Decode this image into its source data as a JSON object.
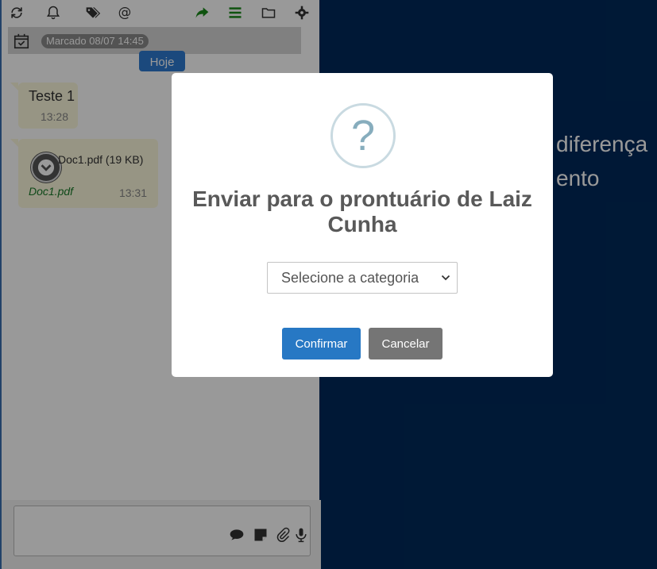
{
  "chat": {
    "scheduled_label": "Marcado 08/07 14:45",
    "day_badge": "Hoje",
    "messages": [
      {
        "text": "Teste 1",
        "time": "13:28"
      },
      {
        "file_name": "Doc1.pdf (19 KB)",
        "file_link": "Doc1.pdf",
        "time": "13:31"
      }
    ]
  },
  "background_text": {
    "line1": "diferença",
    "line2": "ento"
  },
  "modal": {
    "title": "Enviar para o prontuário de Laiz Cunha",
    "select_placeholder": "Selecione a categoria",
    "confirm_label": "Confirmar",
    "cancel_label": "Cancelar"
  },
  "colors": {
    "accent": "#2778c4",
    "toolbar_green": "#1a8a1a",
    "background": "#00295a"
  },
  "icons": {
    "toolbar": [
      "refresh-icon",
      "bell-icon",
      "tags-icon",
      "at-icon",
      "share-icon",
      "list-icon",
      "folder-icon",
      "gear-icon"
    ],
    "composer": [
      "comment-icon",
      "sticky-note-icon",
      "paperclip-icon",
      "microphone-icon"
    ]
  }
}
